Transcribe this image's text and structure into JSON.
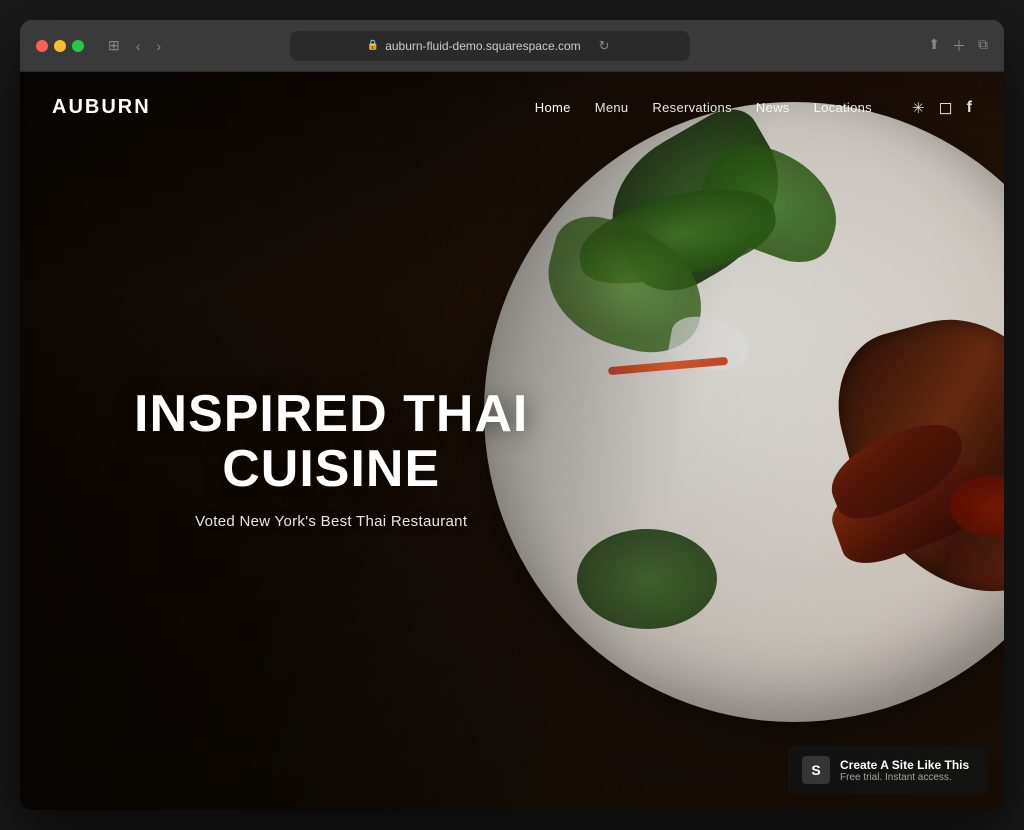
{
  "browser": {
    "url": "auburn-fluid-demo.squarespace.com",
    "controls": {
      "back": "‹",
      "forward": "›"
    }
  },
  "site": {
    "logo": "AUBURN",
    "nav": {
      "links": [
        {
          "label": "Home",
          "active": true
        },
        {
          "label": "Menu",
          "active": false
        },
        {
          "label": "Reservations",
          "active": false
        },
        {
          "label": "News",
          "active": false
        },
        {
          "label": "Locations",
          "active": false
        }
      ],
      "socials": [
        {
          "name": "yelp-icon",
          "symbol": "✳"
        },
        {
          "name": "instagram-icon",
          "symbol": "◻"
        },
        {
          "name": "facebook-icon",
          "symbol": "f"
        }
      ]
    },
    "hero": {
      "title_line1": "INSPIRED THAI",
      "title_line2": "CUISINE",
      "subtitle": "Voted New York's Best Thai Restaurant"
    },
    "cta": {
      "title": "Create A Site Like This",
      "subtitle": "Free trial. Instant access.",
      "icon_label": "S"
    }
  }
}
